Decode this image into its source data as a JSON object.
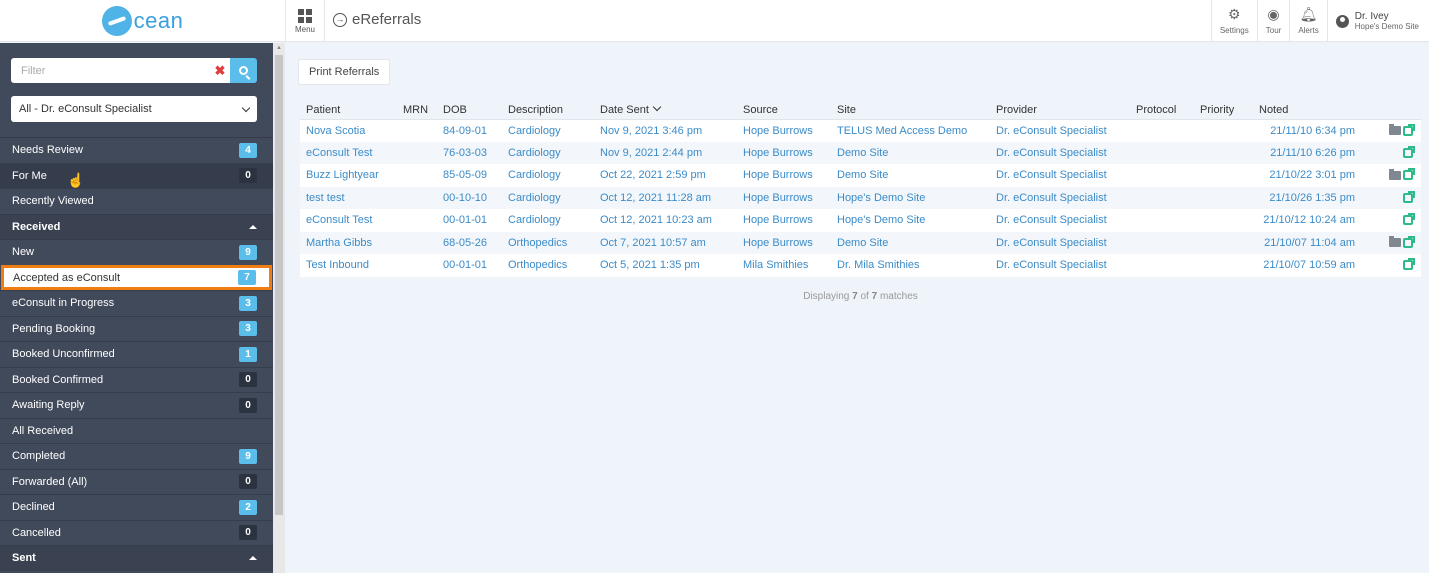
{
  "app": {
    "logo_text": "cean"
  },
  "header": {
    "menu_label": "Menu",
    "title": "eReferrals",
    "actions": [
      {
        "label": "Settings",
        "icon": "gear-icon"
      },
      {
        "label": "Tour",
        "icon": "compass-icon"
      },
      {
        "label": "Alerts",
        "icon": "bell-icon"
      }
    ],
    "user": {
      "name": "Dr. Ivey",
      "site": "Hope's Demo Site"
    }
  },
  "sidebar": {
    "filter_placeholder": "Filter",
    "select_value": "All - Dr. eConsult Specialist",
    "items": [
      {
        "label": "Needs Review",
        "badge": "4",
        "badge_style": "blue"
      },
      {
        "label": "For Me",
        "badge": "0",
        "badge_style": "dark"
      },
      {
        "label": "Recently Viewed",
        "badge": "",
        "badge_style": ""
      },
      {
        "label": "Received",
        "badge": "",
        "badge_style": ""
      },
      {
        "label": "New",
        "badge": "9",
        "badge_style": "blue"
      },
      {
        "label": "Accepted as eConsult",
        "badge": "7",
        "badge_style": "blue"
      },
      {
        "label": "eConsult in Progress",
        "badge": "3",
        "badge_style": "blue"
      },
      {
        "label": "Pending Booking",
        "badge": "3",
        "badge_style": "blue"
      },
      {
        "label": "Booked Unconfirmed",
        "badge": "1",
        "badge_style": "blue"
      },
      {
        "label": "Booked Confirmed",
        "badge": "0",
        "badge_style": "dark"
      },
      {
        "label": "Awaiting Reply",
        "badge": "0",
        "badge_style": "dark"
      },
      {
        "label": "All Received",
        "badge": "",
        "badge_style": ""
      },
      {
        "label": "Completed",
        "badge": "9",
        "badge_style": "blue"
      },
      {
        "label": "Forwarded (All)",
        "badge": "0",
        "badge_style": "dark"
      },
      {
        "label": "Declined",
        "badge": "2",
        "badge_style": "blue"
      },
      {
        "label": "Cancelled",
        "badge": "0",
        "badge_style": "dark"
      },
      {
        "label": "Sent",
        "badge": "",
        "badge_style": ""
      }
    ]
  },
  "main": {
    "print_button": "Print Referrals",
    "columns": [
      "Patient",
      "MRN",
      "DOB",
      "Description",
      "Date Sent",
      "Source",
      "Site",
      "Provider",
      "Protocol",
      "Priority",
      "Noted"
    ],
    "rows": [
      {
        "patient": "Nova Scotia",
        "mrn": "",
        "dob": "84-09-01",
        "description": "Cardiology",
        "date_sent": "Nov 9, 2021 3:46 pm",
        "source": "Hope Burrows",
        "site": "TELUS Med Access Demo",
        "provider": "Dr. eConsult Specialist",
        "protocol": "",
        "priority": "",
        "noted": "21/11/10 6:34 pm",
        "folder": true
      },
      {
        "patient": "eConsult Test",
        "mrn": "",
        "dob": "76-03-03",
        "description": "Cardiology",
        "date_sent": "Nov 9, 2021 2:44 pm",
        "source": "Hope Burrows",
        "site": "Demo Site",
        "provider": "Dr. eConsult Specialist",
        "protocol": "",
        "priority": "",
        "noted": "21/11/10 6:26 pm",
        "folder": false
      },
      {
        "patient": "Buzz Lightyear",
        "mrn": "",
        "dob": "85-05-09",
        "description": "Cardiology",
        "date_sent": "Oct 22, 2021 2:59 pm",
        "source": "Hope Burrows",
        "site": "Demo Site",
        "provider": "Dr. eConsult Specialist",
        "protocol": "",
        "priority": "",
        "noted": "21/10/22 3:01 pm",
        "folder": true
      },
      {
        "patient": "test test",
        "mrn": "",
        "dob": "00-10-10",
        "description": "Cardiology",
        "date_sent": "Oct 12, 2021 11:28 am",
        "source": "Hope Burrows",
        "site": "Hope's Demo Site",
        "provider": "Dr. eConsult Specialist",
        "protocol": "",
        "priority": "",
        "noted": "21/10/26 1:35 pm",
        "folder": false
      },
      {
        "patient": "eConsult Test",
        "mrn": "",
        "dob": "00-01-01",
        "description": "Cardiology",
        "date_sent": "Oct 12, 2021 10:23 am",
        "source": "Hope Burrows",
        "site": "Hope's Demo Site",
        "provider": "Dr. eConsult Specialist",
        "protocol": "",
        "priority": "",
        "noted": "21/10/12 10:24 am",
        "folder": false
      },
      {
        "patient": "Martha Gibbs",
        "mrn": "",
        "dob": "68-05-26",
        "description": "Orthopedics",
        "date_sent": "Oct 7, 2021 10:57 am",
        "source": "Hope Burrows",
        "site": "Demo Site",
        "provider": "Dr. eConsult Specialist",
        "protocol": "",
        "priority": "",
        "noted": "21/10/07 11:04 am",
        "folder": true
      },
      {
        "patient": "Test Inbound",
        "mrn": "",
        "dob": "00-01-01",
        "description": "Orthopedics",
        "date_sent": "Oct 5, 2021 1:35 pm",
        "source": "Mila Smithies",
        "site": "Dr. Mila Smithies",
        "provider": "Dr. eConsult Specialist",
        "protocol": "",
        "priority": "",
        "noted": "21/10/07 10:59 am",
        "folder": false
      }
    ],
    "footer": {
      "prefix": "Displaying",
      "shown": "7",
      "of_word": "of",
      "total": "7",
      "suffix": "matches"
    }
  }
}
